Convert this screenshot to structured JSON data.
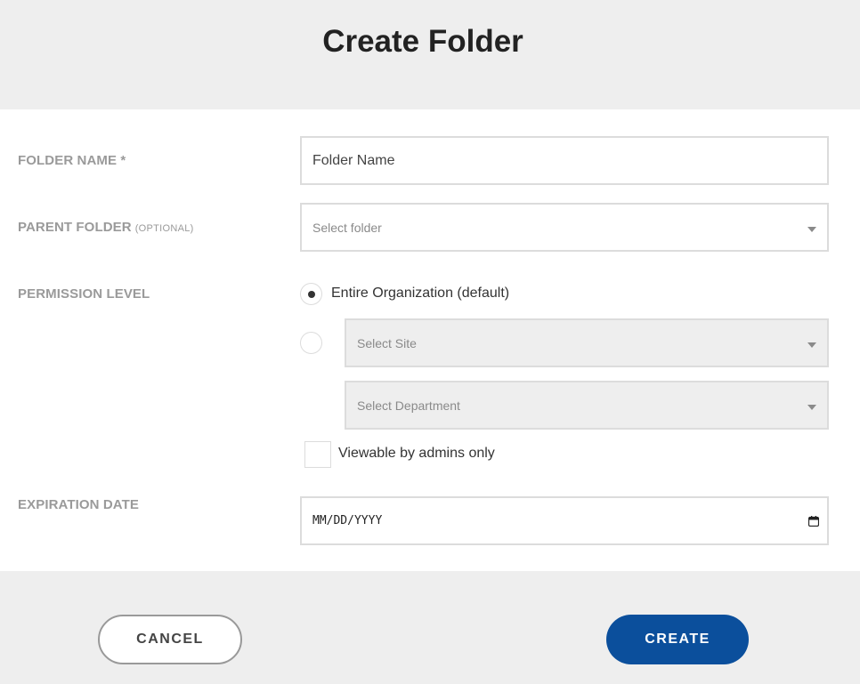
{
  "dialog": {
    "title": "Create Folder"
  },
  "form": {
    "folder_name": {
      "label": "FOLDER NAME *",
      "value": "Folder Name"
    },
    "parent_folder": {
      "label": "PARENT FOLDER",
      "optional_tag": "(OPTIONAL)",
      "placeholder": "Select folder"
    },
    "permission_level": {
      "label": "PERMISSION LEVEL",
      "option_org": "Entire Organization (default)",
      "option_org_selected": true,
      "site_placeholder": "Select Site",
      "department_placeholder": "Select Department",
      "admins_only_label": "Viewable by admins only",
      "admins_only_checked": false
    },
    "expiration_date": {
      "label": "EXPIRATION DATE",
      "placeholder": "MM/DD/YYYY"
    }
  },
  "footer": {
    "cancel_label": "CANCEL",
    "create_label": "CREATE"
  },
  "colors": {
    "primary": "#0b4f9c",
    "header_bg": "#eeeeee",
    "label_gray": "#9a9a9a"
  },
  "icons": {
    "dropdown": "caret-down-icon",
    "date": "calendar-icon"
  }
}
